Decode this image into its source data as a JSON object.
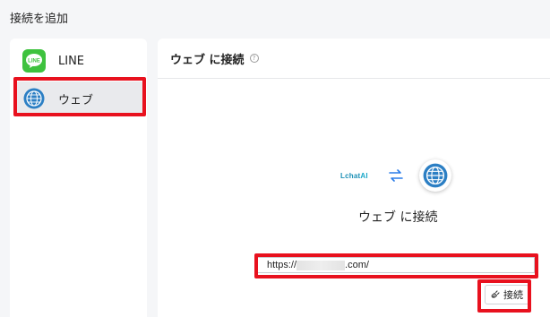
{
  "page": {
    "title": "接続を追加"
  },
  "sidebar": {
    "items": [
      {
        "label": "LINE",
        "icon": "line-app-icon",
        "selected": false
      },
      {
        "label": "ウェブ",
        "icon": "globe-icon",
        "selected": true
      }
    ]
  },
  "main": {
    "title": "ウェブ に接続",
    "help_icon": "?",
    "visual": {
      "logo_text_main": "Lchat",
      "logo_text_ai": "AI",
      "sync_icon": "sync-arrows-icon",
      "target_icon": "globe-icon"
    },
    "heading": "ウェブ に接続",
    "url_prefix": "https://",
    "url_suffix": ".com/",
    "connect_button_label": "接続"
  },
  "colors": {
    "highlight": "#e8111e",
    "line_green": "#3ec23e",
    "globe_blue": "#2c7fc4",
    "sync_blue": "#2b7de9"
  }
}
